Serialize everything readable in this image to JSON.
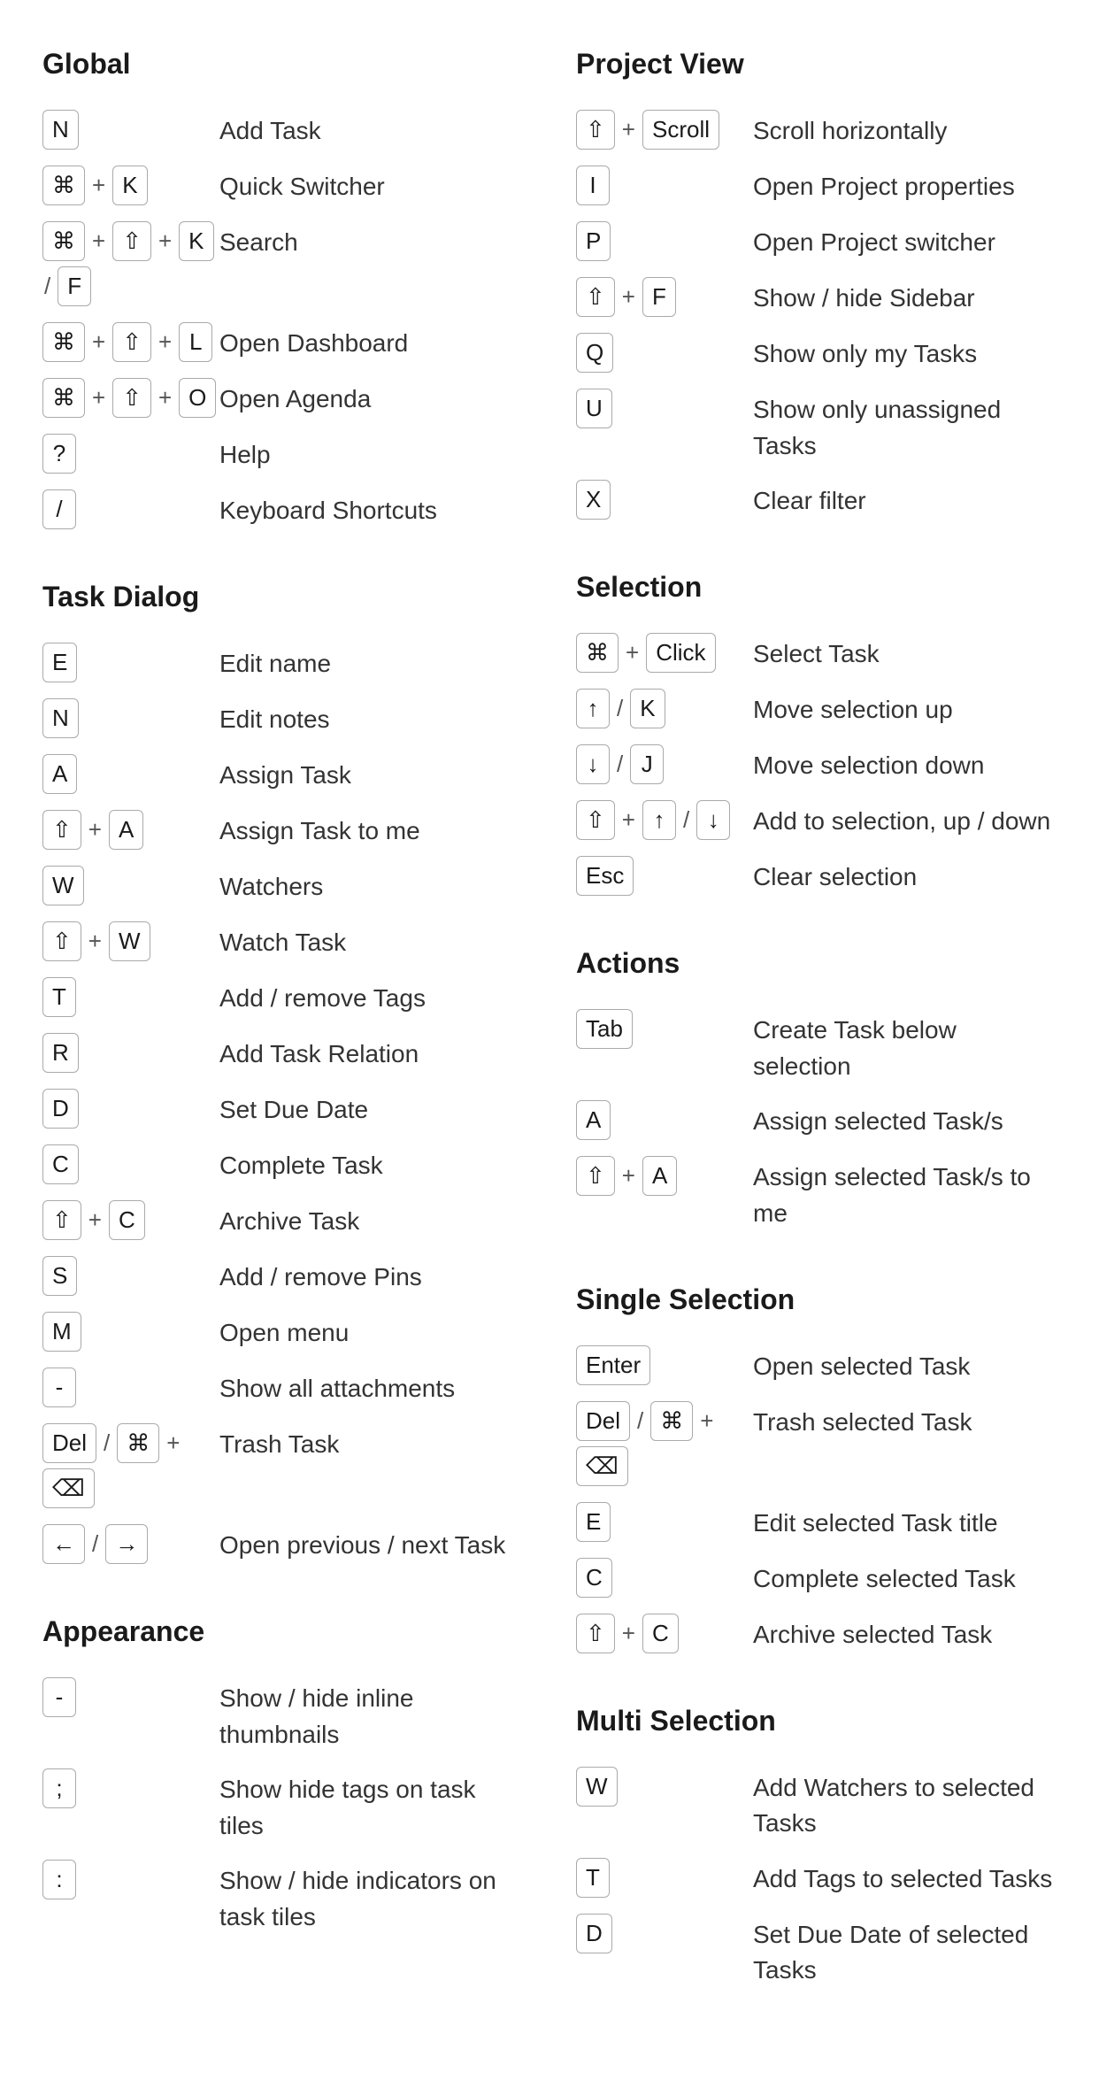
{
  "global": {
    "title": "Global",
    "shortcuts": [
      {
        "keys": [
          [
            "N"
          ]
        ],
        "desc": "Add Task"
      },
      {
        "keys": [
          [
            "⌘"
          ],
          "+",
          [
            "K"
          ]
        ],
        "desc": "Quick Switcher"
      },
      {
        "keys": [
          [
            "⌘"
          ],
          "+",
          [
            "⇧"
          ],
          "+",
          [
            "K"
          ],
          "/",
          [
            "F"
          ]
        ],
        "desc": "Search"
      },
      {
        "keys": [
          [
            "⌘"
          ],
          "+",
          [
            "⇧"
          ],
          "+",
          [
            "L"
          ]
        ],
        "desc": "Open Dashboard"
      },
      {
        "keys": [
          [
            "⌘"
          ],
          "+",
          [
            "⇧"
          ],
          "+",
          [
            "O"
          ]
        ],
        "desc": "Open Agenda"
      },
      {
        "keys": [
          [
            "?"
          ]
        ],
        "desc": "Help"
      },
      {
        "keys": [
          [
            "//"
          ]
        ],
        "desc": "Keyboard Shortcuts"
      }
    ]
  },
  "taskDialog": {
    "title": "Task Dialog",
    "shortcuts": [
      {
        "keys": [
          [
            "E"
          ]
        ],
        "desc": "Edit name"
      },
      {
        "keys": [
          [
            "N"
          ]
        ],
        "desc": "Edit notes"
      },
      {
        "keys": [
          [
            "A"
          ]
        ],
        "desc": "Assign Task"
      },
      {
        "keys": [
          [
            "⇧"
          ],
          "+",
          [
            "A"
          ]
        ],
        "desc": "Assign Task to me"
      },
      {
        "keys": [
          [
            "W"
          ]
        ],
        "desc": "Watchers"
      },
      {
        "keys": [
          [
            "⇧"
          ],
          "+",
          [
            "W"
          ]
        ],
        "desc": "Watch Task"
      },
      {
        "keys": [
          [
            "T"
          ]
        ],
        "desc": "Add / remove Tags"
      },
      {
        "keys": [
          [
            "R"
          ]
        ],
        "desc": "Add Task Relation"
      },
      {
        "keys": [
          [
            "D"
          ]
        ],
        "desc": "Set Due Date"
      },
      {
        "keys": [
          [
            "C"
          ]
        ],
        "desc": "Complete Task"
      },
      {
        "keys": [
          [
            "⇧"
          ],
          "+",
          [
            "C"
          ]
        ],
        "desc": "Archive Task"
      },
      {
        "keys": [
          [
            "S"
          ]
        ],
        "desc": "Add / remove Pins"
      },
      {
        "keys": [
          [
            "M"
          ]
        ],
        "desc": "Open menu"
      },
      {
        "keys": [
          [
            "-"
          ]
        ],
        "desc": "Show all attachments"
      },
      {
        "keys": [
          [
            "Del"
          ],
          "/",
          [
            "⌘"
          ],
          "+",
          [
            "⌫"
          ]
        ],
        "desc": "Trash Task"
      },
      {
        "keys": [
          [
            "←"
          ],
          "/",
          [
            "→"
          ]
        ],
        "desc": "Open previous / next Task"
      }
    ]
  },
  "appearance": {
    "title": "Appearance",
    "shortcuts": [
      {
        "keys": [
          [
            "-"
          ]
        ],
        "desc": "Show / hide inline thumbnails"
      },
      {
        "keys": [
          [
            ";"
          ]
        ],
        "desc": "Show hide tags on task tiles"
      },
      {
        "keys": [
          [
            ":"
          ]
        ],
        "desc": "Show / hide indicators on task tiles"
      }
    ]
  },
  "projectView": {
    "title": "Project View",
    "shortcuts": [
      {
        "keys": [
          [
            "⇧"
          ],
          "+",
          [
            "Scroll"
          ]
        ],
        "desc": "Scroll horizontally"
      },
      {
        "keys": [
          [
            "I"
          ]
        ],
        "desc": "Open Project properties"
      },
      {
        "keys": [
          [
            "P"
          ]
        ],
        "desc": "Open Project switcher"
      },
      {
        "keys": [
          [
            "⇧"
          ],
          "+",
          [
            "F"
          ]
        ],
        "desc": "Show / hide Sidebar"
      },
      {
        "keys": [
          [
            "Q"
          ]
        ],
        "desc": "Show only my Tasks"
      },
      {
        "keys": [
          [
            "U"
          ]
        ],
        "desc": "Show only unassigned Tasks"
      },
      {
        "keys": [
          [
            "X"
          ]
        ],
        "desc": "Clear filter"
      }
    ]
  },
  "selection": {
    "title": "Selection",
    "shortcuts": [
      {
        "keys": [
          [
            "⌘"
          ],
          "+",
          [
            "Click"
          ]
        ],
        "desc": "Select Task"
      },
      {
        "keys": [
          [
            "↑"
          ],
          "/",
          [
            "K"
          ]
        ],
        "desc": "Move selection up"
      },
      {
        "keys": [
          [
            "↓"
          ],
          "/",
          [
            "J"
          ]
        ],
        "desc": "Move selection down"
      },
      {
        "keys": [
          [
            "⇧"
          ],
          "+",
          [
            "↑"
          ],
          "/",
          [
            "↓"
          ]
        ],
        "desc": "Add to selection, up / down"
      },
      {
        "keys": [
          [
            "Esc"
          ]
        ],
        "desc": "Clear selection"
      }
    ]
  },
  "actions": {
    "title": "Actions",
    "shortcuts": [
      {
        "keys": [
          [
            "Tab"
          ]
        ],
        "desc": "Create Task below selection"
      },
      {
        "keys": [
          [
            "A"
          ]
        ],
        "desc": "Assign selected Task/s"
      },
      {
        "keys": [
          [
            "⇧"
          ],
          "+",
          [
            "A"
          ]
        ],
        "desc": "Assign selected Task/s to me"
      }
    ]
  },
  "singleSelection": {
    "title": "Single Selection",
    "shortcuts": [
      {
        "keys": [
          [
            "Enter"
          ]
        ],
        "desc": "Open selected Task"
      },
      {
        "keys": [
          [
            "Del"
          ],
          "/",
          [
            "⌘"
          ],
          "+",
          [
            "⌫"
          ]
        ],
        "desc": "Trash selected Task"
      },
      {
        "keys": [
          [
            "E"
          ]
        ],
        "desc": "Edit selected Task title"
      },
      {
        "keys": [
          [
            "C"
          ]
        ],
        "desc": "Complete selected Task"
      },
      {
        "keys": [
          [
            "⇧"
          ],
          "+",
          [
            "C"
          ]
        ],
        "desc": "Archive selected Task"
      }
    ]
  },
  "multiSelection": {
    "title": "Multi Selection",
    "shortcuts": [
      {
        "keys": [
          [
            "W"
          ]
        ],
        "desc": "Add Watchers to selected Tasks"
      },
      {
        "keys": [
          [
            "T"
          ]
        ],
        "desc": "Add Tags to selected Tasks"
      },
      {
        "keys": [
          [
            "D"
          ]
        ],
        "desc": "Set Due Date of selected Tasks"
      }
    ]
  }
}
